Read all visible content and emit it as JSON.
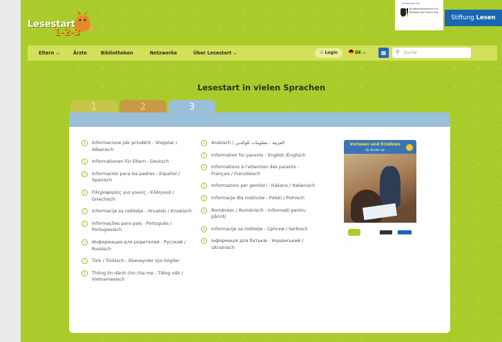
{
  "header": {
    "logo_text": "Lesestart",
    "logo_num": "1-2-3",
    "bmbf_top": "GEFÖRDERT VOM",
    "bmbf_name": "Bundesministerium für Bildung und Forschung",
    "stiftung_a": "Stiftung ",
    "stiftung_b": "Lesen"
  },
  "nav": {
    "items": [
      {
        "label": "Eltern",
        "has_chevron": true
      },
      {
        "label": "Ärzte"
      },
      {
        "label": "Bibliotheken"
      },
      {
        "label": "Netzwerke"
      },
      {
        "label": "Über Lesestart",
        "has_chevron": true
      }
    ],
    "login": "Login",
    "language": "DE",
    "search_placeholder": "Suche",
    "icons": [
      "user-icon",
      "chevron-down-icon",
      "ds-icon",
      "search-icon"
    ]
  },
  "main": {
    "title": "Lesestart in vielen Sprachen",
    "tabs": [
      "1",
      "2",
      "3"
    ],
    "active_tab": "3",
    "left_links": [
      "Informacione për prindërit - Shqiptar / Albanisch",
      "Informationen für Eltern - Deutsch",
      "Información para los padres - Español / Spanisch",
      "Πληροφορίες για γονείς - Ελληνικά / Griechisch",
      "Informacije za roditelje - Hrvatski / Kroatisch",
      "Informações para pais - Português / Portugiesisch",
      "Информация для родителей - Русский / Russisch",
      "Türk / Türkisch - Ebeveynler için bilgiler",
      "Thông tin dành cho cha mẹ - Tiếng việt / Vietnamesisch"
    ],
    "right_links": [
      "Arabisch / العربية - معلومات للوالدين",
      "Information for parents - English /Englisch",
      "Informations à l'attention des parents - Français / Französisch",
      "Informazioni per genitori - Italiano / Italienisch",
      "Informacje dla rodziców - Polski / Polnisch",
      "Românesc / Rumänisch - Informații pentru părinți",
      "Informacije za roditelje - Српски / Serbisch",
      "Інформація для батьків - Український / Ukrainisch"
    ],
    "booklet_title": "Vorlesen und Erzählen",
    "booklet_sub": "für Kinder ab"
  },
  "colors": {
    "page_green": "#a9cc2b",
    "nav_green": "#d2e05a",
    "tab_blue": "#9abfd9",
    "icon_green": "#9fb630"
  }
}
